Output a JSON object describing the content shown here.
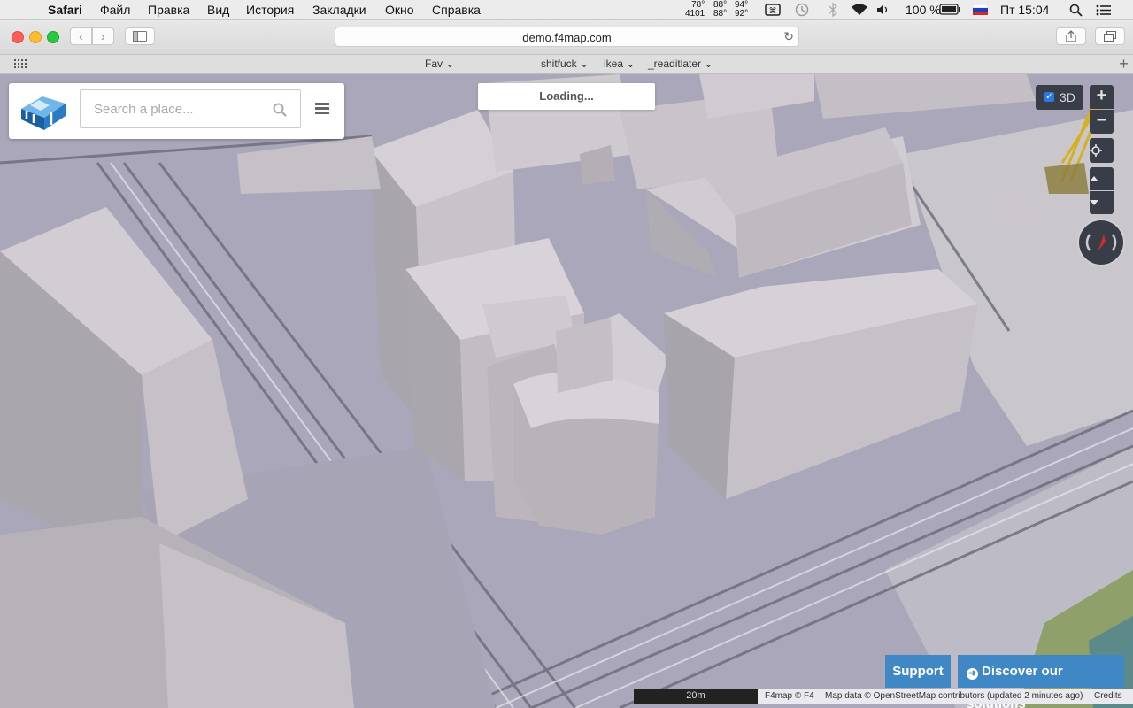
{
  "menubar": {
    "apple_icon": "apple-icon",
    "app": "Safari",
    "items": [
      "Файл",
      "Правка",
      "Вид",
      "История",
      "Закладки",
      "Окно",
      "Справка"
    ],
    "temps": [
      [
        "78°",
        "4101"
      ],
      [
        "88°",
        "88°"
      ],
      [
        "94°",
        "92°"
      ]
    ],
    "battery": "100 %",
    "clock": "Пт 15:04"
  },
  "toolbar": {
    "url": "demo.f4map.com"
  },
  "bookmarks": [
    "Fav",
    "shitfuck",
    "ikea",
    "_readitlater"
  ],
  "map": {
    "search_placeholder": "Search a place...",
    "loading": "Loading...",
    "toggle_3d": "3D",
    "toggle_3d_checked": true,
    "support": "Support",
    "discover": "Discover our solutions",
    "scale": "20m",
    "attribution": [
      "F4map © F4",
      "Map data © OpenStreetMap contributors (updated 2 minutes ago)",
      "Credits"
    ]
  },
  "colors": {
    "button_blue": "#3f88c5",
    "control_dark": "#383d48",
    "building": "#c2bdc2",
    "ground": "#a9a7b9"
  }
}
